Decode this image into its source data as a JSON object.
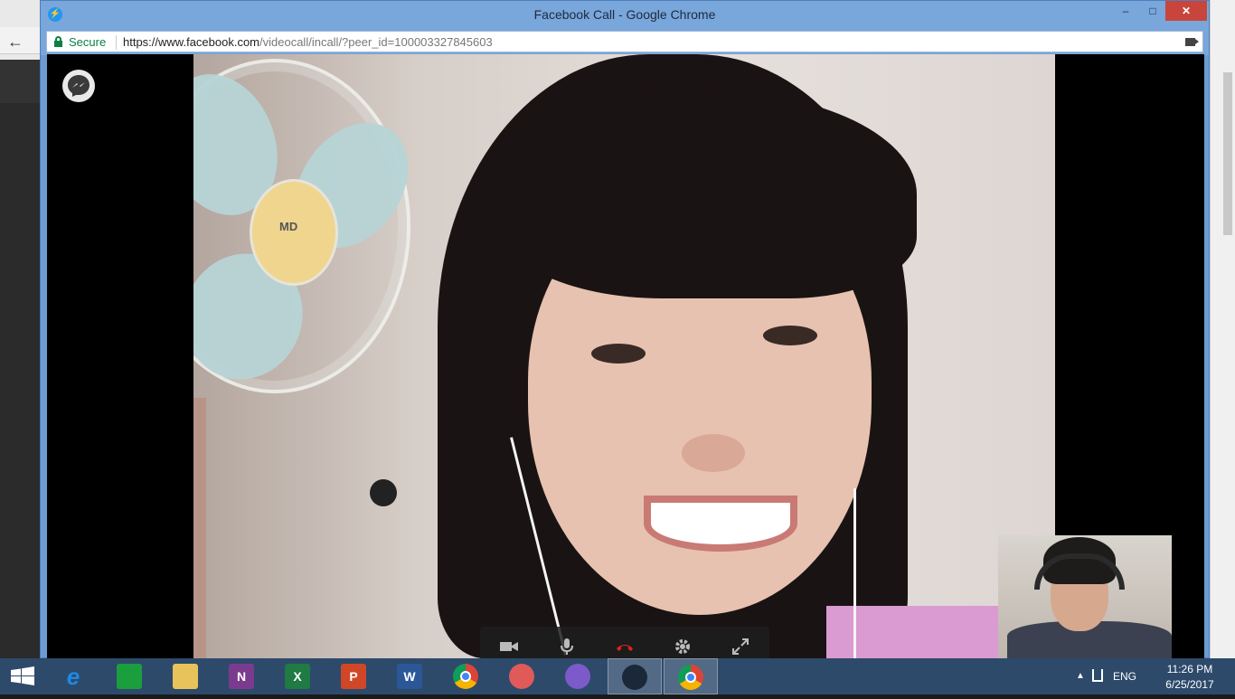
{
  "window": {
    "title": "Facebook Call - Google Chrome",
    "minimize": "–",
    "maximize": "□",
    "close": "✕"
  },
  "omnibox": {
    "secure_label": "Secure",
    "url_host": "https://www.facebook.com",
    "url_path": "/videocall/incall/?peer_id=100003327845603"
  },
  "nav": {
    "back": "←"
  },
  "fan": {
    "brand": "MD"
  },
  "controls": [
    {
      "name": "video-toggle-button",
      "icon": "video-camera-icon"
    },
    {
      "name": "mute-button",
      "icon": "microphone-icon"
    },
    {
      "name": "end-call-button",
      "icon": "hang-up-icon"
    },
    {
      "name": "settings-button",
      "icon": "gear-icon"
    },
    {
      "name": "fullscreen-button",
      "icon": "expand-icon"
    }
  ],
  "taskbar": {
    "apps": [
      {
        "name": "internet-explorer",
        "letter": "e",
        "color": "#1e88e5"
      },
      {
        "name": "store",
        "letter": "",
        "color": "#1b9e3e"
      },
      {
        "name": "file-explorer",
        "letter": "",
        "color": "#e8c25a"
      },
      {
        "name": "onenote",
        "letter": "N",
        "color": "#7a3b8f"
      },
      {
        "name": "excel",
        "letter": "X",
        "color": "#1f7a44"
      },
      {
        "name": "powerpoint",
        "letter": "P",
        "color": "#d04727"
      },
      {
        "name": "word",
        "letter": "W",
        "color": "#2b5797"
      },
      {
        "name": "chrome",
        "letter": "",
        "color": "#ffffff"
      },
      {
        "name": "snipping-tool",
        "letter": "",
        "color": "#e05a5a"
      },
      {
        "name": "viber",
        "letter": "",
        "color": "#7d5ac9"
      },
      {
        "name": "steam",
        "letter": "",
        "color": "#1b2838"
      },
      {
        "name": "chrome-active",
        "letter": "",
        "color": "#ffffff"
      }
    ],
    "tray": {
      "language": "ENG",
      "time": "11:26 PM",
      "date": "6/25/2017"
    }
  }
}
